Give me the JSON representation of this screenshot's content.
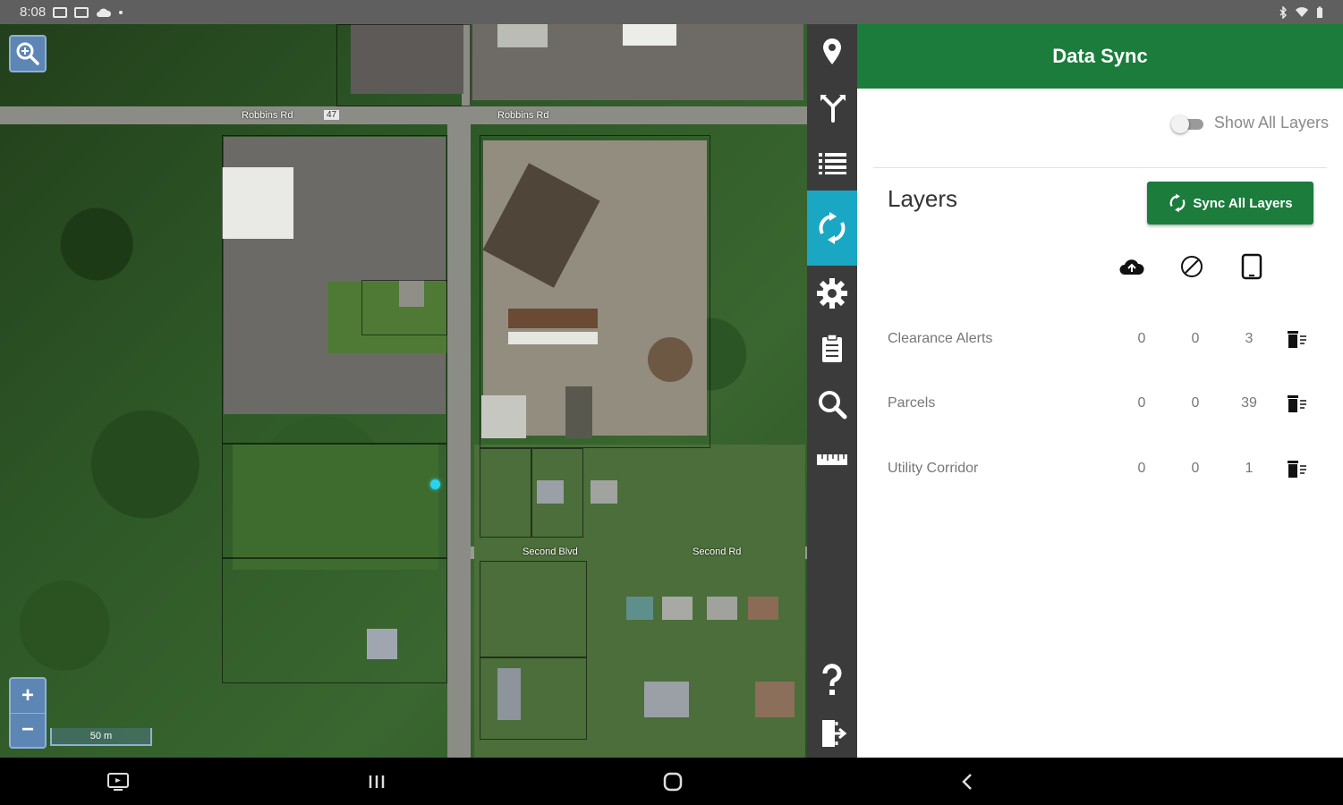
{
  "status_bar": {
    "time": "8:08",
    "left_icons": [
      "image-icon",
      "a-icon",
      "cloud-icon",
      "dot-icon"
    ],
    "right_icons": [
      "bluetooth-icon",
      "wifi-icon",
      "battery-icon"
    ]
  },
  "map": {
    "road_labels": [
      "Robbins Rd",
      "47",
      "Robbins Rd",
      "Second Blvd",
      "Second Rd"
    ],
    "scale_label": "50 m",
    "zoom_in_label": "+",
    "zoom_out_label": "−"
  },
  "toolbar": {
    "items": [
      "location-pin-icon",
      "branch-icon",
      "list-icon",
      "sync-icon",
      "gear-icon",
      "clipboard-icon",
      "search-icon",
      "ruler-icon",
      "help-icon",
      "logout-icon"
    ],
    "active_item": "sync-icon",
    "active_color": "#1aa7c3"
  },
  "panel": {
    "title": "Data Sync",
    "header_color": "#1b7c3c",
    "toggle_label": "Show All Layers",
    "toggle_on": false,
    "section_title": "Layers",
    "sync_button_label": "Sync All Layers",
    "columns": [
      "upload-cloud-icon",
      "cancel-icon",
      "device-icon"
    ],
    "layers": [
      {
        "name": "Clearance Alerts",
        "upload": "0",
        "cancel": "0",
        "device": "3"
      },
      {
        "name": "Parcels",
        "upload": "0",
        "cancel": "0",
        "device": "39"
      },
      {
        "name": "Utility Corridor",
        "upload": "0",
        "cancel": "0",
        "device": "1"
      }
    ]
  },
  "nav_bar": {
    "buttons": [
      "screen-icon",
      "recents-icon",
      "home-icon",
      "back-icon"
    ]
  }
}
